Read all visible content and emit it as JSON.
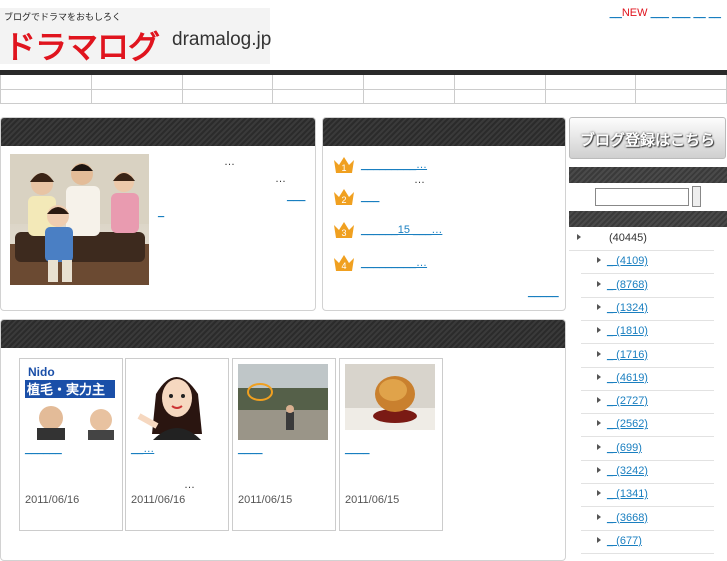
{
  "header": {
    "tagline": "ブログでドラマをおもしろく",
    "logo_text": "ドラマログ",
    "domain": "dramalog.jp",
    "links": [
      "__",
      "NEW",
      "___",
      "___",
      "__",
      "__"
    ]
  },
  "feature": {
    "lines": [
      "…",
      "…",
      "___",
      "_"
    ]
  },
  "ranking": {
    "items": [
      {
        "num": "1",
        "text": "_________…",
        "sub": "…"
      },
      {
        "num": "2",
        "text": "___"
      },
      {
        "num": "3",
        "text": "______15 ___…"
      },
      {
        "num": "4",
        "text": "_________…"
      }
    ],
    "more_link": "_____"
  },
  "posts": [
    {
      "title": "______",
      "sub": "",
      "date": "2011/06/16",
      "image": "hair-ad"
    },
    {
      "title": "__…",
      "sub": "…",
      "date": "2011/06/16",
      "image": "cartoon-woman"
    },
    {
      "title": "____",
      "sub": "",
      "date": "2011/06/15",
      "image": "park-photo"
    },
    {
      "title": "____",
      "sub": "",
      "date": "2011/06/15",
      "image": "food-photo"
    }
  ],
  "ad_text": {
    "brand": "Nido",
    "headline": "植毛・実力主"
  },
  "sidebar": {
    "register_label": "ブログ登録はこちら",
    "categories": [
      {
        "label": "(40445)",
        "level": 0
      },
      {
        "label": "(4109)",
        "level": 1
      },
      {
        "label": "(8768)",
        "level": 1
      },
      {
        "label": "(1324)",
        "level": 1
      },
      {
        "label": "(1810)",
        "level": 1
      },
      {
        "label": "(1716)",
        "level": 1
      },
      {
        "label": "(4619)",
        "level": 1
      },
      {
        "label": "(2727)",
        "level": 1
      },
      {
        "label": "(2562)",
        "level": 1
      },
      {
        "label": "(699)",
        "level": 1
      },
      {
        "label": "(3242)",
        "level": 1
      },
      {
        "label": "(1341)",
        "level": 1
      },
      {
        "label": "(3668)",
        "level": 1
      },
      {
        "label": "(677)",
        "level": 1
      }
    ]
  },
  "colors": {
    "brand_red": "#e0141e",
    "link": "#1a7fc0",
    "dark_bar": "#2a2a2a",
    "crown": "#f0a020"
  }
}
